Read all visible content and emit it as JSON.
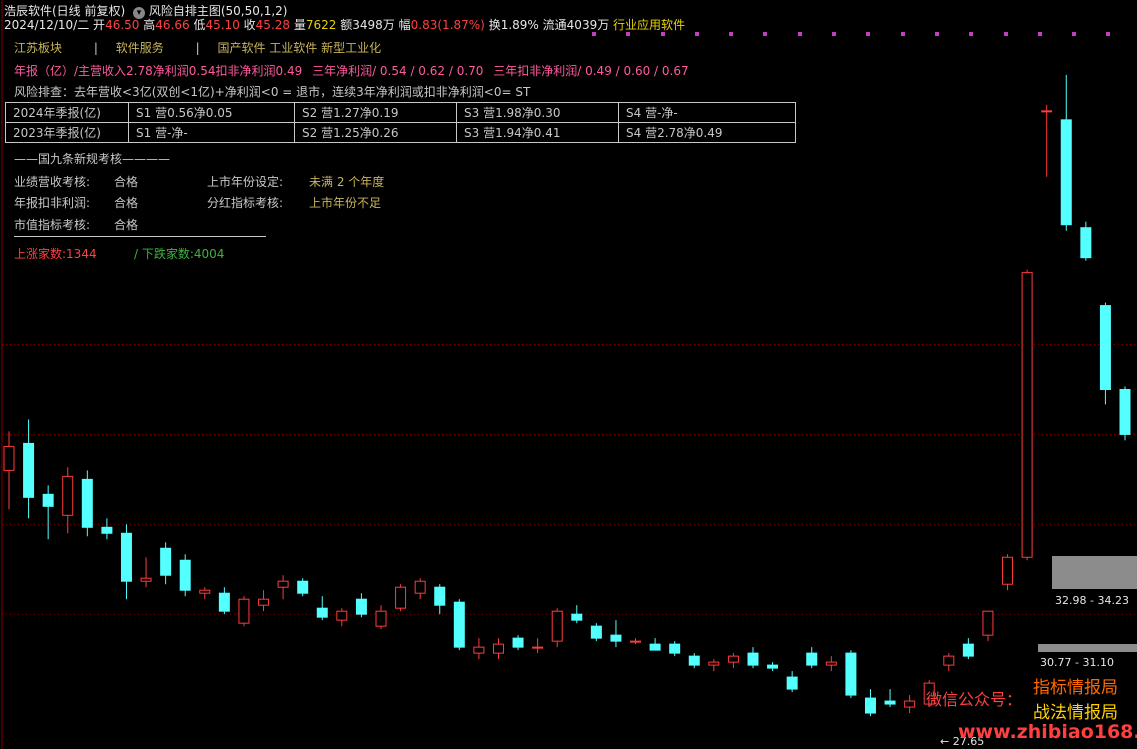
{
  "header": {
    "title": "浩辰软件(日线 前复权)",
    "indicator": "风险自排主图(50,50,1,2)",
    "date": "2024/12/10/二",
    "open_label": "开",
    "open": "46.50",
    "high_label": "高",
    "high": "46.66",
    "low_label": "低",
    "low": "45.10",
    "close_label": "收",
    "close": "45.28",
    "vol_label": "量",
    "vol": "7622",
    "amount_label": "额",
    "amount": "3498万",
    "change_label": "幅",
    "change": "0.83(1.87%)",
    "turnover_label": "换",
    "turnover": "1.89%",
    "float_label": "流通",
    "float": "4039万",
    "industry": "行业应用软件"
  },
  "sectors": {
    "s1": "江苏板块",
    "s2": "软件服务",
    "s3": "国产软件 工业软件 新型工业化",
    "divider": "|"
  },
  "annual": {
    "prefix": "年报（亿）/主营收入",
    "revenue": "2.78",
    "np_label": "净利润",
    "np": "0.54",
    "dnp_label": "扣非净利润",
    "dnp": "0.49",
    "three_np": "三年净利润/ 0.54 / 0.62 / 0.70",
    "three_dnp": "三年扣非净利润/ 0.49 / 0.60 / 0.67"
  },
  "risk": {
    "text": "风险排查：去年营收<3亿(双创<1亿)+净利润<0 = 退市，连续3年净利润或扣非净利润<0= ST"
  },
  "season_table": [
    {
      "label": "2024年季报(亿)",
      "s1": "S1 营0.56净0.05",
      "s2": "S2 营1.27净0.19",
      "s3": "S3 营1.98净0.30",
      "s4": "S4 营-净-"
    },
    {
      "label": "2023年季报(亿)",
      "s1": "S1 营-净-",
      "s2": "S2 营1.25净0.26",
      "s3": "S3 营1.94净0.41",
      "s4": "S4 营2.78净0.49"
    }
  ],
  "nine": {
    "title": "——国九条新规考核————",
    "r1_label": "业绩营收考核:",
    "r1_val": "合格",
    "r1b_label": "上市年份设定:",
    "r1b_val": "未满 2 个年度",
    "r2_label": "年报扣非利润:",
    "r2_val": "合格",
    "r2b_label": "分红指标考核:",
    "r2b_val": "上市年份不足",
    "r3_label": "市值指标考核:",
    "r3_val": "合格"
  },
  "market": {
    "up_label": "上涨家数:",
    "up": "1344",
    "down_label": "/ 下跌家数:",
    "down": "4004"
  },
  "zones": {
    "upper": "32.98 - 34.23",
    "lower": "30.77 - 31.10"
  },
  "low_marker": "← 27.65",
  "watermark": {
    "wechat": "微信公众号：",
    "brand1": "指标情报局",
    "brand2": "战法情报局",
    "site": "www.zhibiao168.com"
  },
  "colors": {
    "up": "#ff3c3c",
    "down": "#54ffff",
    "grid": "#800000",
    "zone": "#8c8c8c"
  },
  "chart_data": {
    "type": "candlestick",
    "title": "",
    "price_range": [
      26.5,
      51.5
    ],
    "last_close": 45.28,
    "min_marker": 27.65,
    "candles": [
      {
        "o": 35.8,
        "h": 37.1,
        "l": 34.5,
        "c": 36.6
      },
      {
        "o": 36.7,
        "h": 37.5,
        "l": 34.2,
        "c": 34.9
      },
      {
        "o": 35.0,
        "h": 35.3,
        "l": 33.5,
        "c": 34.6
      },
      {
        "o": 34.3,
        "h": 35.9,
        "l": 33.7,
        "c": 35.6
      },
      {
        "o": 35.5,
        "h": 35.8,
        "l": 33.6,
        "c": 33.9
      },
      {
        "o": 33.9,
        "h": 34.2,
        "l": 33.5,
        "c": 33.7
      },
      {
        "o": 33.7,
        "h": 34.0,
        "l": 31.5,
        "c": 32.1
      },
      {
        "o": 32.1,
        "h": 32.9,
        "l": 31.9,
        "c": 32.2
      },
      {
        "o": 33.2,
        "h": 33.4,
        "l": 32.0,
        "c": 32.3
      },
      {
        "o": 32.8,
        "h": 33.0,
        "l": 31.6,
        "c": 31.8
      },
      {
        "o": 31.7,
        "h": 31.9,
        "l": 31.5,
        "c": 31.8
      },
      {
        "o": 31.7,
        "h": 31.9,
        "l": 31.0,
        "c": 31.1
      },
      {
        "o": 30.7,
        "h": 31.6,
        "l": 30.6,
        "c": 31.5
      },
      {
        "o": 31.3,
        "h": 31.8,
        "l": 31.1,
        "c": 31.5
      },
      {
        "o": 31.9,
        "h": 32.3,
        "l": 31.5,
        "c": 32.1
      },
      {
        "o": 32.1,
        "h": 32.2,
        "l": 31.6,
        "c": 31.7
      },
      {
        "o": 31.2,
        "h": 31.6,
        "l": 30.8,
        "c": 30.9
      },
      {
        "o": 30.8,
        "h": 31.2,
        "l": 30.6,
        "c": 31.1
      },
      {
        "o": 31.5,
        "h": 31.7,
        "l": 30.9,
        "c": 31.0
      },
      {
        "o": 30.6,
        "h": 31.3,
        "l": 30.5,
        "c": 31.1
      },
      {
        "o": 31.2,
        "h": 32.0,
        "l": 31.1,
        "c": 31.9
      },
      {
        "o": 31.7,
        "h": 32.2,
        "l": 31.5,
        "c": 32.1
      },
      {
        "o": 31.9,
        "h": 32.0,
        "l": 31.0,
        "c": 31.3
      },
      {
        "o": 31.4,
        "h": 31.5,
        "l": 29.8,
        "c": 29.9
      },
      {
        "o": 29.7,
        "h": 30.2,
        "l": 29.5,
        "c": 29.9
      },
      {
        "o": 29.7,
        "h": 30.2,
        "l": 29.5,
        "c": 30.0
      },
      {
        "o": 30.2,
        "h": 30.3,
        "l": 29.8,
        "c": 29.9
      },
      {
        "o": 29.9,
        "h": 30.2,
        "l": 29.7,
        "c": 29.9
      },
      {
        "o": 30.1,
        "h": 31.2,
        "l": 29.9,
        "c": 31.1
      },
      {
        "o": 31.0,
        "h": 31.3,
        "l": 30.7,
        "c": 30.8
      },
      {
        "o": 30.6,
        "h": 30.7,
        "l": 30.1,
        "c": 30.2
      },
      {
        "o": 30.3,
        "h": 30.8,
        "l": 29.9,
        "c": 30.1
      },
      {
        "o": 30.1,
        "h": 30.2,
        "l": 30.0,
        "c": 30.1
      },
      {
        "o": 30.0,
        "h": 30.2,
        "l": 29.8,
        "c": 29.8
      },
      {
        "o": 30.0,
        "h": 30.1,
        "l": 29.6,
        "c": 29.7
      },
      {
        "o": 29.6,
        "h": 29.7,
        "l": 29.2,
        "c": 29.3
      },
      {
        "o": 29.3,
        "h": 29.5,
        "l": 29.1,
        "c": 29.4
      },
      {
        "o": 29.4,
        "h": 29.7,
        "l": 29.2,
        "c": 29.6
      },
      {
        "o": 29.7,
        "h": 29.9,
        "l": 29.2,
        "c": 29.3
      },
      {
        "o": 29.3,
        "h": 29.4,
        "l": 29.1,
        "c": 29.2
      },
      {
        "o": 28.9,
        "h": 29.1,
        "l": 28.4,
        "c": 28.5
      },
      {
        "o": 29.7,
        "h": 29.9,
        "l": 29.2,
        "c": 29.3
      },
      {
        "o": 29.3,
        "h": 29.6,
        "l": 29.1,
        "c": 29.4
      },
      {
        "o": 29.7,
        "h": 29.8,
        "l": 28.2,
        "c": 28.3
      },
      {
        "o": 28.2,
        "h": 28.5,
        "l": 27.6,
        "c": 27.7
      },
      {
        "o": 28.1,
        "h": 28.5,
        "l": 27.9,
        "c": 28.0
      },
      {
        "o": 27.9,
        "h": 28.3,
        "l": 27.7,
        "c": 28.1
      },
      {
        "o": 28.0,
        "h": 28.8,
        "l": 27.9,
        "c": 28.7
      },
      {
        "o": 29.3,
        "h": 29.7,
        "l": 29.1,
        "c": 29.6
      },
      {
        "o": 30.0,
        "h": 30.2,
        "l": 29.5,
        "c": 29.6
      },
      {
        "o": 30.3,
        "h": 31.0,
        "l": 30.1,
        "c": 31.1
      },
      {
        "o": 32.0,
        "h": 33.0,
        "l": 31.8,
        "c": 32.9
      },
      {
        "o": 32.9,
        "h": 42.5,
        "l": 32.8,
        "c": 42.4
      },
      {
        "o": 47.8,
        "h": 48.0,
        "l": 45.6,
        "c": 47.8
      },
      {
        "o": 47.5,
        "h": 49.0,
        "l": 43.8,
        "c": 44.0
      },
      {
        "o": 43.9,
        "h": 44.1,
        "l": 42.8,
        "c": 42.9
      },
      {
        "o": 41.3,
        "h": 41.4,
        "l": 38.0,
        "c": 38.5
      },
      {
        "o": 38.5,
        "h": 38.6,
        "l": 36.8,
        "c": 37.0
      }
    ]
  }
}
